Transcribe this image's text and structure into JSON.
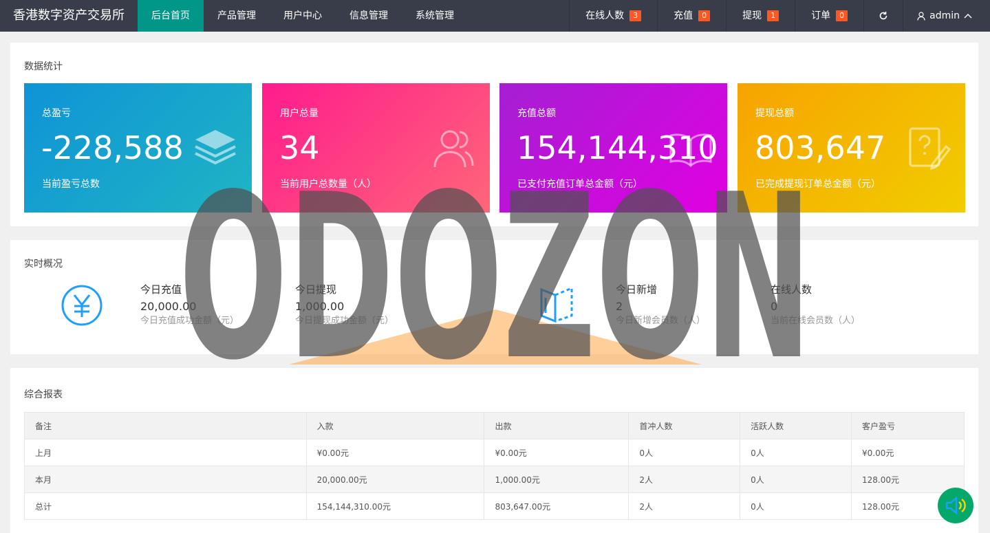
{
  "header": {
    "brand": "香港数字资产交易所",
    "nav": [
      "后台首页",
      "产品管理",
      "用户中心",
      "信息管理",
      "系统管理"
    ],
    "active_nav": "后台首页",
    "right": [
      {
        "label": "在线人数",
        "badge": "3"
      },
      {
        "label": "充值",
        "badge": "0"
      },
      {
        "label": "提现",
        "badge": "1"
      },
      {
        "label": "订单",
        "badge": "0"
      }
    ],
    "user": "admin"
  },
  "stats": {
    "title": "数据统计",
    "cards": [
      {
        "label": "总盈亏",
        "value": "-228,588",
        "desc": "当前盈亏总数",
        "icon": "layers-icon"
      },
      {
        "label": "用户总量",
        "value": "34",
        "desc": "当前用户总数量（人）",
        "icon": "users-icon"
      },
      {
        "label": "充值总额",
        "value": "154,144,310",
        "desc": "已支付充值订单总金额（元）",
        "icon": "book-icon"
      },
      {
        "label": "提现总额",
        "value": "803,647",
        "desc": "已完成提现订单总金额（元）",
        "icon": "question-note-icon"
      }
    ]
  },
  "realtime": {
    "title": "实时概况",
    "items": [
      {
        "title": "今日充值",
        "value": "20,000.00",
        "desc": "今日充值成功金额（元）"
      },
      {
        "title": "今日提现",
        "value": "1,000.00",
        "desc": "今日提现成功金额（元）"
      },
      {
        "title": "今日新增",
        "value": "2",
        "desc": "今日新增会员数（人）"
      },
      {
        "title": "在线人数",
        "value": "0",
        "desc": "当前在线会员数（人）"
      }
    ]
  },
  "report": {
    "title": "综合报表",
    "columns": [
      "备注",
      "入款",
      "出款",
      "首冲人数",
      "活跃人数",
      "客户盈亏"
    ],
    "rows": [
      [
        "上月",
        "¥0.00元",
        "¥0.00元",
        "0人",
        "0人",
        "¥0.00元"
      ],
      [
        "本月",
        "20,000.00元",
        "1,000.00元",
        "2人",
        "0人",
        "128.00元"
      ],
      [
        "总计",
        "154,144,310.00元",
        "803,647.00元",
        "2人",
        "0人",
        "128.00元"
      ]
    ]
  },
  "watermark": "ODOZON",
  "colors": {
    "nav_bg": "#393d49",
    "nav_active": "#009688",
    "badge": "#ff5722",
    "accent_blue": "#1e9fff",
    "float_button": "#05a86b"
  }
}
